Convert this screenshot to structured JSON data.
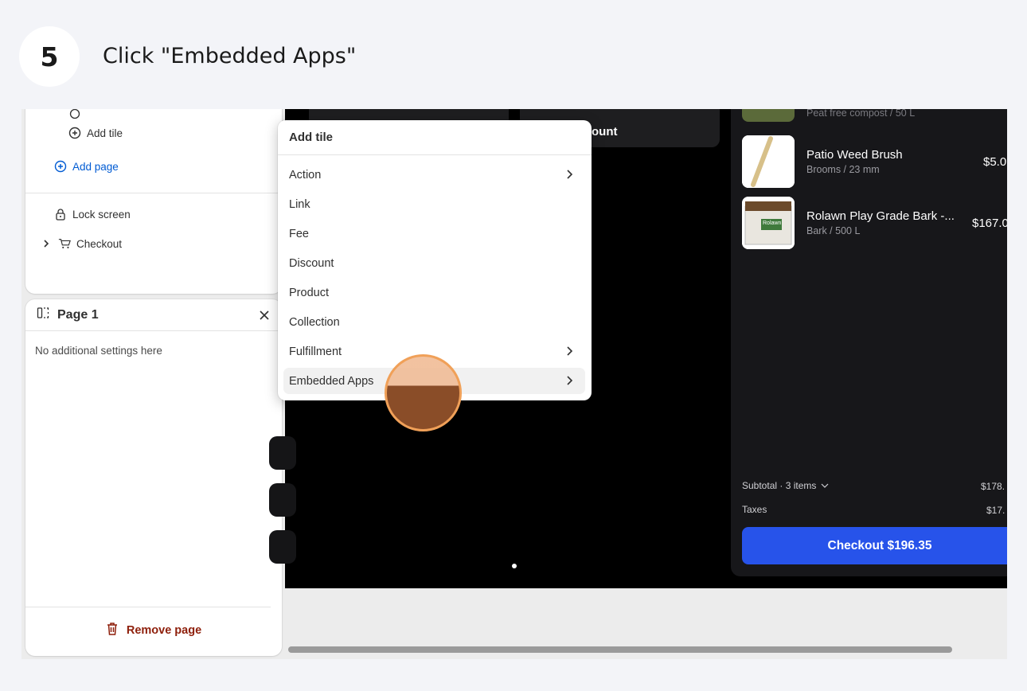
{
  "step": {
    "number": "5",
    "title": "Click \"Embedded Apps\""
  },
  "editor": {
    "tree": {
      "add_tile": "Add tile",
      "add_page": "Add page",
      "lock_screen": "Lock screen",
      "checkout": "Checkout"
    },
    "page_panel": {
      "title": "Page 1",
      "note": "No additional settings here",
      "remove_label": "Remove page"
    }
  },
  "preview": {
    "tile_partial_text": "ount",
    "cart": {
      "items": [
        {
          "name": "Patio Weed Brush",
          "sub": "Brooms / 23 mm",
          "price": "$5.0"
        },
        {
          "name": "Rolawn Play Grade Bark -...",
          "sub": "Bark / 500 L",
          "price": "$167.0"
        }
      ],
      "top_item_partial": "Peat free compost / 50 L",
      "thumb_label": "Rolawn",
      "subtotal_label": "Subtotal · 3 items",
      "subtotal_value": "$178.",
      "taxes_label": "Taxes",
      "taxes_value": "$17.",
      "checkout_label": "Checkout $196.35"
    }
  },
  "menu": {
    "title": "Add tile",
    "items": [
      {
        "label": "Action",
        "has_submenu": true
      },
      {
        "label": "Link",
        "has_submenu": false
      },
      {
        "label": "Fee",
        "has_submenu": false
      },
      {
        "label": "Discount",
        "has_submenu": false
      },
      {
        "label": "Product",
        "has_submenu": false
      },
      {
        "label": "Collection",
        "has_submenu": false
      },
      {
        "label": "Fulfillment",
        "has_submenu": true
      },
      {
        "label": "Embedded Apps",
        "has_submenu": true
      }
    ],
    "highlighted": "Embedded Apps"
  },
  "colors": {
    "accent": "#005bd3",
    "checkout": "#2753ea",
    "danger": "#8e1f0b",
    "cursor": "#f0a058"
  }
}
